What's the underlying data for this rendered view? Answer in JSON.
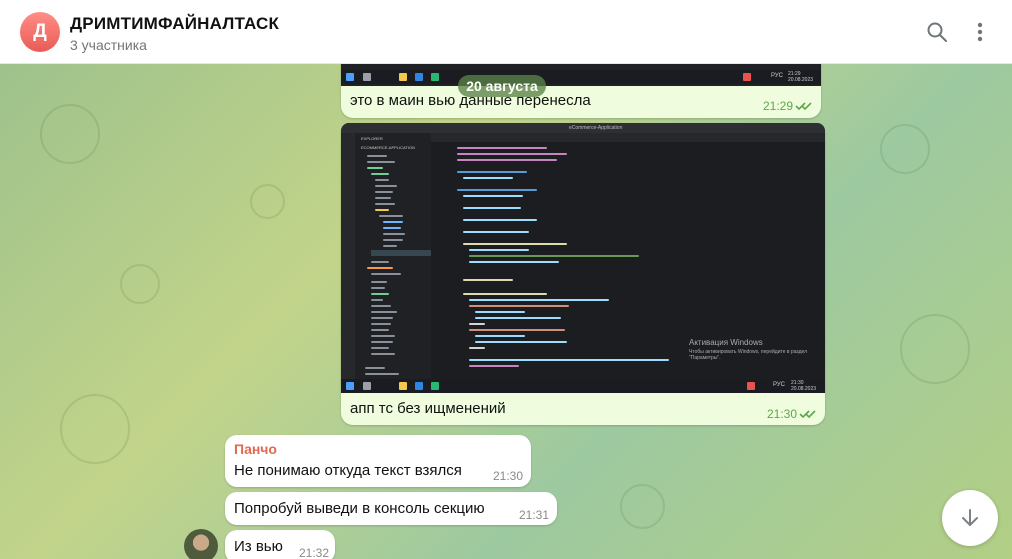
{
  "header": {
    "avatar_letter": "Д",
    "title": "ДРИМТИМФАЙНАЛТАСК",
    "subtitle": "3 участника",
    "search_icon": "search-icon",
    "more_icon": "more-vertical-icon"
  },
  "date_divider": "20 августа",
  "messages": [
    {
      "text": "это в маин вью данные перенесла",
      "time": "21:29",
      "type": "outgoing",
      "has_image": true
    },
    {
      "text": "апп тс без ищменений",
      "time": "21:30",
      "type": "outgoing",
      "has_image": true
    },
    {
      "sender": "Панчо",
      "text": "Не понимаю откуда текст взялся",
      "time": "21:30",
      "type": "incoming"
    },
    {
      "text": "Попробуй выведи в консоль секцию",
      "time": "21:31",
      "type": "incoming"
    },
    {
      "text": "Из вью",
      "time": "21:32",
      "type": "incoming"
    }
  ],
  "screenshot": {
    "window_title": "eCommerce-Application",
    "explorer_title": "EXPLORER",
    "project_name": "ECOMMERCE-APPLICATION",
    "activation_title": "Активация Windows",
    "activation_sub": "Чтобы активировать Windows, перейдите в раздел \"Параметры\".",
    "clock_time_1": "21:29",
    "clock_time_2": "21:30",
    "clock_date": "20.08.2023",
    "lang": "РУС"
  },
  "scroll_down_icon": "arrow-down-icon",
  "colors": {
    "accent": "#5ea64a",
    "out_bubble": "#effdde",
    "in_bubble": "#ffffff",
    "sender": "#e0694f"
  }
}
